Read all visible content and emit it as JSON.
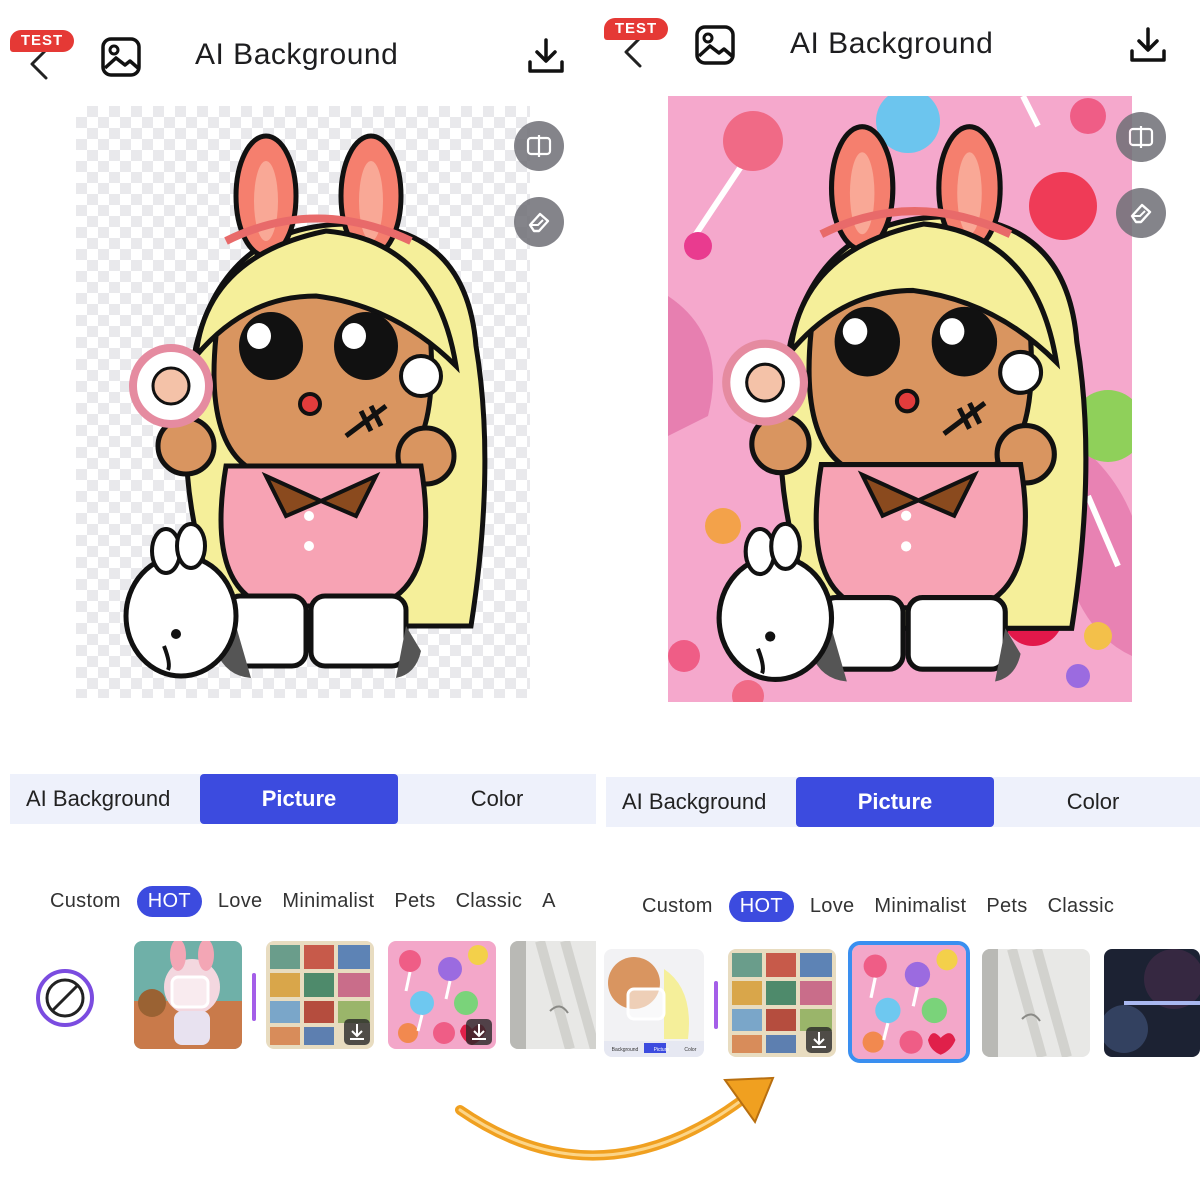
{
  "colors": {
    "accent": "#3c4bdf",
    "test_badge": "#e53935",
    "tab_bar_bg": "#eef1fb",
    "selected_outline": "#3a8ff0",
    "arrow": "#f0a020"
  },
  "panels": [
    {
      "header": {
        "test_badge": "TEST",
        "back_icon": "chevron-left-icon",
        "gallery_icon": "image-icon",
        "title": "AI Background",
        "download_icon": "download-icon"
      },
      "canvas": {
        "background": "transparent-checkerboard"
      },
      "side_buttons": [
        "compare-icon",
        "eraser-icon"
      ],
      "tabs": [
        "AI Background",
        "Picture",
        "Color"
      ],
      "active_tab": "Picture",
      "categories": [
        "Custom",
        "HOT",
        "Love",
        "Minimalist",
        "Pets",
        "Classic",
        "A"
      ],
      "active_category": "HOT",
      "thumbnails": [
        "none",
        "bunny-girl-scene",
        "vintage-stamps",
        "candy-lollipops",
        "window-shadow"
      ]
    },
    {
      "header": {
        "test_badge": "TEST",
        "back_icon": "chevron-left-icon",
        "gallery_icon": "image-icon",
        "title": "AI Background",
        "download_icon": "download-icon"
      },
      "canvas": {
        "background": "candy-lollipops"
      },
      "side_buttons": [
        "compare-icon",
        "eraser-icon"
      ],
      "tabs": [
        "AI Background",
        "Picture",
        "Color"
      ],
      "active_tab": "Picture",
      "categories": [
        "Custom",
        "HOT",
        "Love",
        "Minimalist",
        "Pets",
        "Classic"
      ],
      "active_category": "HOT",
      "thumbnails": [
        "custom-photo",
        "vintage-stamps",
        "candy-lollipops",
        "window-shadow",
        "galaxy"
      ],
      "selected_thumbnail": "candy-lollipops"
    }
  ],
  "mini_tabs": [
    "Background",
    "Picture",
    "Color"
  ]
}
